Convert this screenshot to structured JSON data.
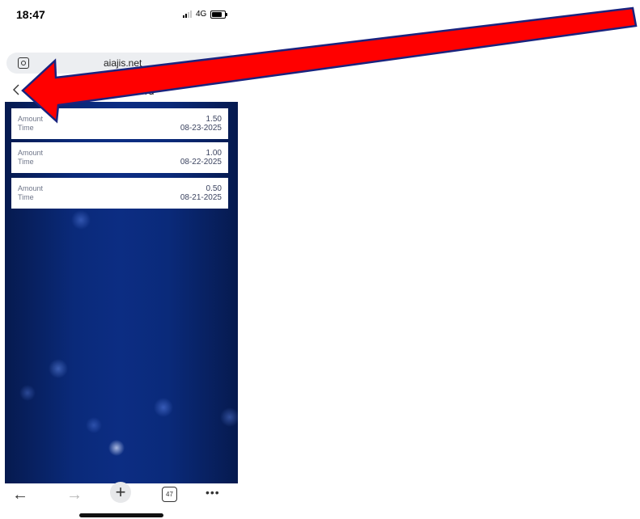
{
  "status_bar": {
    "time": "18:47",
    "network": "4G"
  },
  "browser": {
    "url": "aiajis.net"
  },
  "page": {
    "title": "Sign-in record"
  },
  "records": [
    {
      "amount_label": "Amount",
      "amount": "1.50",
      "time_label": "Time",
      "time": "08-23-2025"
    },
    {
      "amount_label": "Amount",
      "amount": "1.00",
      "time_label": "Time",
      "time": "08-22-2025"
    },
    {
      "amount_label": "Amount",
      "amount": "0.50",
      "time_label": "Time",
      "time": "08-21-2025"
    }
  ],
  "toolbar": {
    "back_icon": "arrow-left",
    "forward_icon": "arrow-right",
    "new_tab_icon": "plus",
    "tab_count": "47",
    "more_icon": "ellipsis"
  },
  "annotation": {
    "arrow_color": "#ff0000",
    "arrow_outline": "#1a237e"
  }
}
